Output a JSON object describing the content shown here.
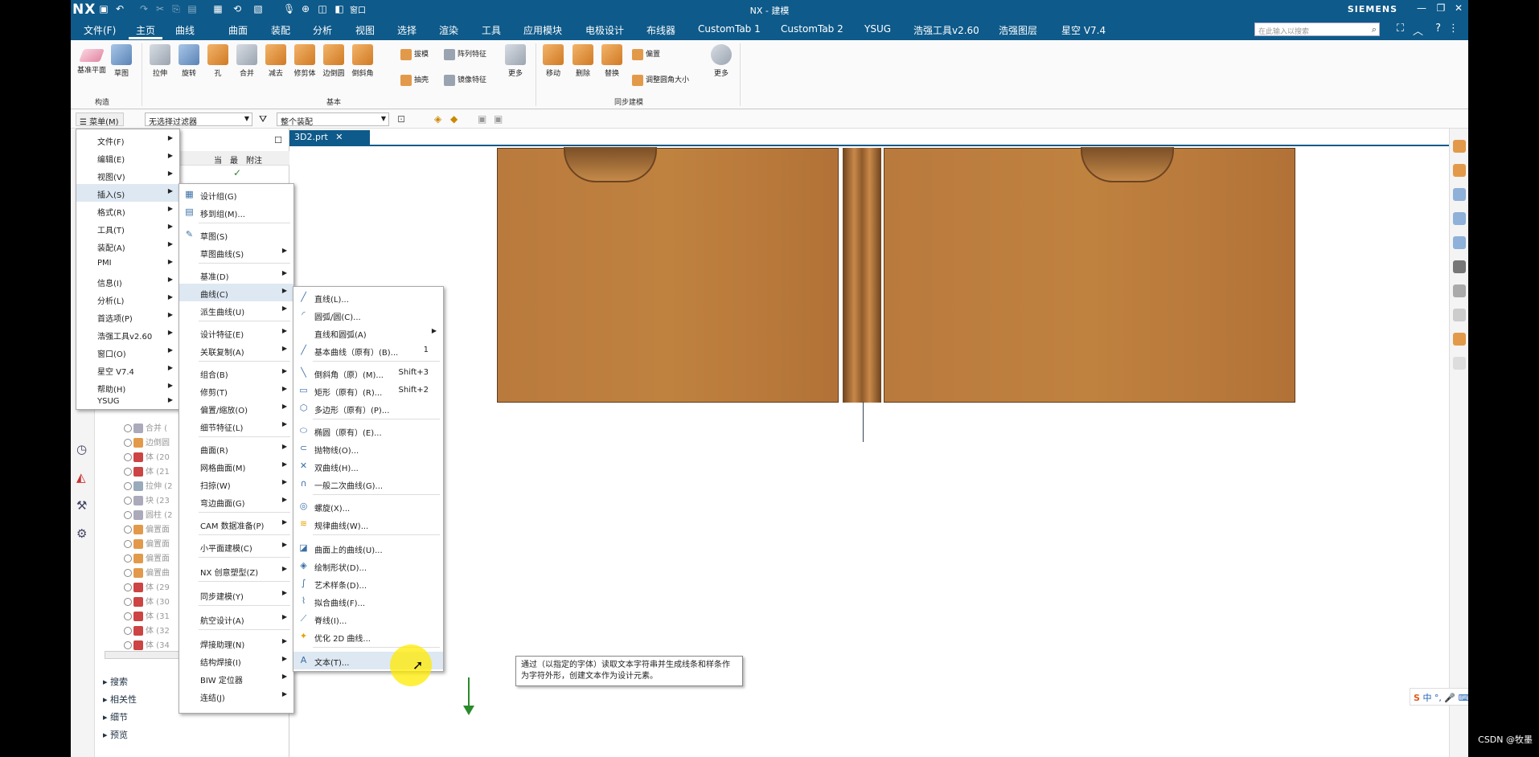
{
  "app": {
    "logo": "NX",
    "window_title": "NX - 建模",
    "brand": "SIEMENS",
    "quick_access": {
      "window_menu": "窗口"
    }
  },
  "menu_tabs": [
    "文件(F)",
    "主页",
    "曲线",
    "曲面",
    "装配",
    "分析",
    "视图",
    "选择",
    "渲染",
    "工具",
    "应用模块",
    "电极设计",
    "布线器",
    "CustomTab 1",
    "CustomTab 2",
    "YSUG",
    "浩强工具v2.60",
    "浩强图层",
    "星空 V7.4"
  ],
  "search_placeholder": "在此输入以搜索",
  "ribbon": {
    "construct": {
      "label": "构造",
      "items": [
        "基准平面",
        "草图"
      ]
    },
    "basic": {
      "label": "基本",
      "items": [
        "拉伸",
        "旋转",
        "孔",
        "合并",
        "减去",
        "修剪体",
        "边倒圆",
        "倒斜角"
      ],
      "small": [
        "拔模",
        "抽壳",
        "阵列特征",
        "镜像特征"
      ],
      "more": "更多"
    },
    "sync": {
      "label": "同步建模",
      "items": [
        "移动",
        "删除",
        "替换"
      ],
      "small": [
        "偏置",
        "调整圆角大小"
      ],
      "more": "更多"
    }
  },
  "filterbar": {
    "menu_label": "菜单(M)",
    "filter": "无选择过滤器",
    "scope": "整个装配"
  },
  "nav": {
    "columns": [
      "当",
      "最",
      "附注"
    ],
    "rows": [
      "合并 (",
      "边倒圆",
      "体 (20",
      "体 (21",
      "拉伸 (2",
      "块 (23",
      "圆柱 (2",
      "偏置面",
      "偏置面",
      "偏置面",
      "偏置曲",
      "体 (29",
      "体 (30",
      "体 (31",
      "体 (32",
      "体 (34"
    ],
    "sections": [
      "搜索",
      "相关性",
      "细节",
      "预览"
    ]
  },
  "doc_tab": "3D2.prt",
  "main_menu": [
    "文件(F)",
    "编辑(E)",
    "视图(V)",
    "插入(S)",
    "格式(R)",
    "工具(T)",
    "装配(A)",
    "PMI",
    "信息(I)",
    "分析(L)",
    "首选项(P)",
    "浩强工具v2.60",
    "窗口(O)",
    "星空 V7.4",
    "帮助(H)",
    "YSUG"
  ],
  "insert_menu": [
    "设计组(G)",
    "移到组(M)...",
    "草图(S)",
    "草图曲线(S)",
    "基准(D)",
    "曲线(C)",
    "派生曲线(U)",
    "设计特征(E)",
    "关联复制(A)",
    "组合(B)",
    "修剪(T)",
    "偏置/缩放(O)",
    "细节特征(L)",
    "曲面(R)",
    "网格曲面(M)",
    "扫掠(W)",
    "弯边曲面(G)",
    "CAM 数据准备(P)",
    "小平面建模(C)",
    "NX 创意塑型(Z)",
    "同步建模(Y)",
    "航空设计(A)",
    "焊接助理(N)",
    "结构焊接(I)",
    "BIW 定位器",
    "连结(J)"
  ],
  "curve_menu": [
    {
      "label": "直线(L)..."
    },
    {
      "label": "圆弧/圆(C)..."
    },
    {
      "label": "直线和圆弧(A)"
    },
    {
      "label": "基本曲线（原有）(B)...",
      "shortcut": "1"
    },
    {
      "label": "倒斜角（原）(M)...",
      "shortcut": "Shift+3"
    },
    {
      "label": "矩形（原有）(R)...",
      "shortcut": "Shift+2"
    },
    {
      "label": "多边形（原有）(P)..."
    },
    {
      "label": "椭圆（原有）(E)..."
    },
    {
      "label": "抛物线(O)..."
    },
    {
      "label": "双曲线(H)..."
    },
    {
      "label": "一般二次曲线(G)..."
    },
    {
      "label": "螺旋(X)..."
    },
    {
      "label": "规律曲线(W)..."
    },
    {
      "label": "曲面上的曲线(U)..."
    },
    {
      "label": "绘制形状(D)..."
    },
    {
      "label": "艺术样条(D)..."
    },
    {
      "label": "拟合曲线(F)..."
    },
    {
      "label": "脊线(I)..."
    },
    {
      "label": "优化 2D 曲线..."
    },
    {
      "label": "文本(T)..."
    }
  ],
  "tooltip": "通过（以指定的字体）读取文本字符串并生成线条和样条作为字符外形，创建文本作为设计元素。",
  "ime": "中 °, 🎤 ⌨",
  "watermark": "CSDN @牧墨"
}
